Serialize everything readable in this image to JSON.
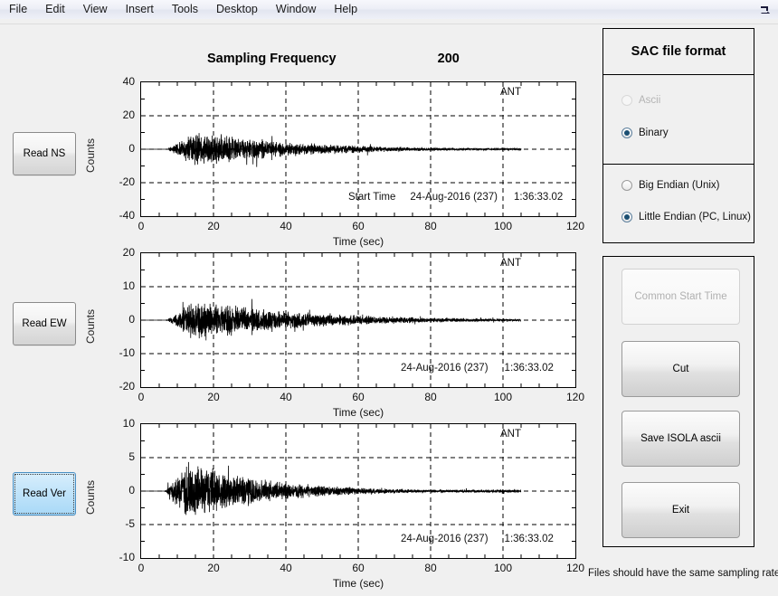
{
  "window": {
    "menu": [
      "File",
      "Edit",
      "View",
      "Insert",
      "Tools",
      "Desktop",
      "Window",
      "Help"
    ],
    "dock_icon": "dock-arrow-icon"
  },
  "header": {
    "title": "Sampling Frequency",
    "value": "200"
  },
  "left_buttons": [
    {
      "label": "Read NS",
      "focused": false
    },
    {
      "label": "Read EW",
      "focused": false
    },
    {
      "label": "Read Ver",
      "focused": true
    }
  ],
  "format_panel": {
    "title": "SAC file format",
    "encoding_options": [
      {
        "label": "Ascii",
        "checked": false,
        "disabled": true
      },
      {
        "label": "Binary",
        "checked": true,
        "disabled": false
      }
    ],
    "endian_options": [
      {
        "label": "Big Endian  (Unix)",
        "checked": false,
        "disabled": false
      },
      {
        "label": "Little Endian (PC, Linux)",
        "checked": true,
        "disabled": false
      }
    ]
  },
  "action_buttons": [
    {
      "label": "Common Start Time",
      "disabled": true
    },
    {
      "label": "Cut",
      "disabled": false
    },
    {
      "label": "Save ISOLA ascii",
      "disabled": false
    },
    {
      "label": "Exit",
      "disabled": false
    }
  ],
  "footer": {
    "note": "Files should have the same sampling rate"
  },
  "colors": {
    "background": "#f0f0f0",
    "plot_background": "#ffffff",
    "trace": "#000000",
    "grid": "#000000",
    "focus_highlight": "#bfe3fa",
    "radio_dot": "#1b4f72",
    "disabled_text": "#b4b4b4"
  },
  "chart_data": [
    {
      "type": "line",
      "id": "trace-ns",
      "title": "",
      "xlabel": "Time (sec)",
      "ylabel": "Counts",
      "xlim": [
        0,
        120
      ],
      "ylim": [
        -40,
        40
      ],
      "xticks": [
        0,
        20,
        40,
        60,
        80,
        100,
        120
      ],
      "yticks": [
        -40,
        -20,
        0,
        20,
        40
      ],
      "grid": true,
      "grid_style": "dashed",
      "station_label": "ANT",
      "start_time_label": "Start Time",
      "start_date": "24-Aug-2016  (237)",
      "start_clock": "1:36:33.02",
      "signal": {
        "t_start": 0.0,
        "t_end": 105.0,
        "quiet_until": 7.0,
        "onset": 7.0,
        "peak_time": 16.0,
        "peak_amplitude": 23.0,
        "coda_decay_sec": 26.0,
        "tail_amplitude": 1.2,
        "seed": 11
      }
    },
    {
      "type": "line",
      "id": "trace-ew",
      "title": "",
      "xlabel": "Time (sec)",
      "ylabel": "Counts",
      "xlim": [
        0,
        120
      ],
      "ylim": [
        -20,
        20
      ],
      "xticks": [
        0,
        20,
        40,
        60,
        80,
        100,
        120
      ],
      "yticks": [
        -20,
        -10,
        0,
        10,
        20
      ],
      "grid": true,
      "grid_style": "dashed",
      "station_label": "ANT",
      "start_time_label": "",
      "start_date": "24-Aug-2016  (237)",
      "start_clock": "1:36:33.02",
      "signal": {
        "t_start": 0.0,
        "t_end": 105.0,
        "quiet_until": 7.0,
        "onset": 7.0,
        "peak_time": 15.0,
        "peak_amplitude": 13.0,
        "coda_decay_sec": 30.0,
        "tail_amplitude": 0.6,
        "seed": 27
      }
    },
    {
      "type": "line",
      "id": "trace-ver",
      "title": "",
      "xlabel": "Time (sec)",
      "ylabel": "Counts",
      "xlim": [
        0,
        120
      ],
      "ylim": [
        -10,
        10
      ],
      "xticks": [
        0,
        20,
        40,
        60,
        80,
        100,
        120
      ],
      "yticks": [
        -10,
        -5,
        0,
        5,
        10
      ],
      "grid": true,
      "grid_style": "dashed",
      "station_label": "ANT",
      "start_time_label": "",
      "start_date": "24-Aug-2016  (237)",
      "start_clock": "1:36:33.02",
      "signal": {
        "t_start": 0.0,
        "t_end": 105.0,
        "quiet_until": 6.5,
        "onset": 6.5,
        "peak_time": 13.0,
        "peak_amplitude": 9.0,
        "coda_decay_sec": 22.0,
        "tail_amplitude": 0.45,
        "seed": 43
      }
    }
  ]
}
